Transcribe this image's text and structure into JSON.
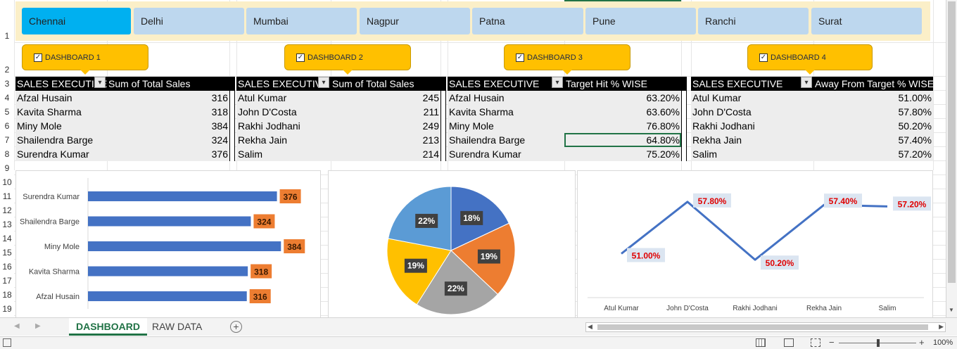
{
  "slicer": {
    "items": [
      "Chennai",
      "Delhi",
      "Mumbai",
      "Nagpur",
      "Patna",
      "Pune",
      "Ranchi",
      "Surat"
    ],
    "selected": "Chennai"
  },
  "row_numbers": [
    "1",
    "2",
    "3",
    "4",
    "5",
    "6",
    "7",
    "8",
    "9",
    "10",
    "11",
    "12",
    "13",
    "14",
    "15",
    "16",
    "17",
    "18",
    "19"
  ],
  "dashboards": [
    {
      "label": "DASHBOARD 1",
      "checked": true
    },
    {
      "label": "DASHBOARD 2",
      "checked": true
    },
    {
      "label": "DASHBOARD 3",
      "checked": true
    },
    {
      "label": "DASHBOARD 4",
      "checked": true
    }
  ],
  "tables": [
    {
      "col1": "SALES EXECUTIVE",
      "col2": "Sum of Total Sales",
      "rows": [
        {
          "name": "Afzal Husain",
          "value": "316"
        },
        {
          "name": "Kavita Sharma",
          "value": "318"
        },
        {
          "name": "Miny Mole",
          "value": "384"
        },
        {
          "name": "Shailendra Barge",
          "value": "324"
        },
        {
          "name": "Surendra Kumar",
          "value": "376"
        }
      ]
    },
    {
      "col1": "SALES EXECUTIVE",
      "col2": "Sum of Total Sales",
      "rows": [
        {
          "name": "Atul Kumar",
          "value": "245"
        },
        {
          "name": "John D'Costa",
          "value": "211"
        },
        {
          "name": "Rakhi Jodhani",
          "value": "249"
        },
        {
          "name": "Rekha Jain",
          "value": "213"
        },
        {
          "name": "Salim",
          "value": "214"
        }
      ]
    },
    {
      "col1": "SALES EXECUTIVE",
      "col2": "Target Hit % WISE",
      "rows": [
        {
          "name": "Afzal Husain",
          "value": "63.20%"
        },
        {
          "name": "Kavita Sharma",
          "value": "63.60%"
        },
        {
          "name": "Miny Mole",
          "value": "76.80%"
        },
        {
          "name": "Shailendra Barge",
          "value": "64.80%"
        },
        {
          "name": "Surendra Kumar",
          "value": "75.20%"
        }
      ]
    },
    {
      "col1": "SALES EXECUTIVE",
      "col2": "Away From Target % WISE",
      "rows": [
        {
          "name": "Atul Kumar",
          "value": "51.00%"
        },
        {
          "name": "John D'Costa",
          "value": "57.80%"
        },
        {
          "name": "Rakhi Jodhani",
          "value": "50.20%"
        },
        {
          "name": "Rekha Jain",
          "value": "57.40%"
        },
        {
          "name": "Salim",
          "value": "57.20%"
        }
      ]
    }
  ],
  "chart_data": [
    {
      "type": "bar",
      "orientation": "horizontal",
      "categories": [
        "Surendra Kumar",
        "Shailendra Barge",
        "Miny Mole",
        "Kavita Sharma",
        "Afzal Husain"
      ],
      "values": [
        376,
        324,
        384,
        318,
        316
      ],
      "labels": [
        "376",
        "324",
        "384",
        "318",
        "316"
      ],
      "bar_color": "#4472c4",
      "label_bg": "#ed7d31"
    },
    {
      "type": "pie",
      "values": [
        18,
        19,
        22,
        19,
        22
      ],
      "labels": [
        "18%",
        "19%",
        "22%",
        "19%",
        "22%"
      ],
      "colors": [
        "#4472c4",
        "#ed7d31",
        "#a5a5a5",
        "#ffc000",
        "#5b9bd5"
      ]
    },
    {
      "type": "line",
      "categories": [
        "Atul Kumar",
        "John D'Costa",
        "Rakhi Jodhani",
        "Rekha Jain",
        "Salim"
      ],
      "values": [
        51.0,
        57.8,
        50.2,
        57.4,
        57.2
      ],
      "labels": [
        "51.00%",
        "57.80%",
        "50.20%",
        "57.40%",
        "57.20%"
      ],
      "line_color": "#4472c4",
      "label_color": "#e00000"
    }
  ],
  "sheet_tabs": [
    "DASHBOARD",
    "RAW DATA"
  ],
  "active_tab": "DASHBOARD",
  "zoom": "100%"
}
